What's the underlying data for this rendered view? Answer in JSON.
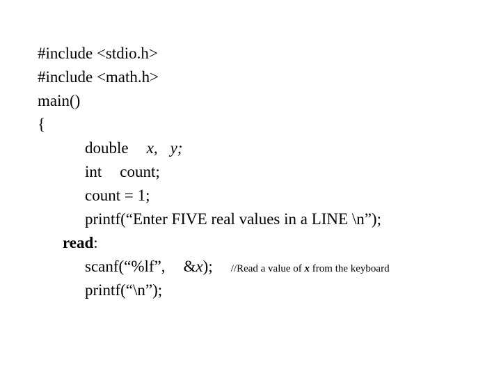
{
  "document": {
    "type": "c-source-code-listing",
    "background_color": "#ffffff",
    "text_color": "#000000",
    "lines": [
      {
        "id": "include-stdio",
        "indent": "top",
        "text": "#include <stdio.h>"
      },
      {
        "id": "include-math",
        "indent": "top",
        "text": "#include <math.h>"
      },
      {
        "id": "main-declaration",
        "indent": "top",
        "text": "main()"
      },
      {
        "id": "open-brace",
        "indent": "top",
        "text": "{"
      },
      {
        "id": "declare-doubles",
        "indent": "body",
        "keyword": "double",
        "var_x": "x,",
        "var_y": "y;"
      },
      {
        "id": "declare-int-count",
        "indent": "body",
        "keyword": "int",
        "identifier": "count;"
      },
      {
        "id": "assign-count",
        "indent": "body",
        "text": "count = 1;"
      },
      {
        "id": "printf-prompt",
        "indent": "body",
        "text": "printf(“Enter FIVE real values in a LINE \\n”);"
      },
      {
        "id": "read-label",
        "indent": "label",
        "label": "read",
        "punctuation": ":"
      },
      {
        "id": "scanf-value",
        "indent": "body",
        "code_before_var": "scanf(“%lf”,",
        "address_operator": "&",
        "var": "x",
        "code_after_var": ");",
        "comment_prefix": "//Read a value of",
        "comment_var": "x",
        "comment_suffix": "from the keyboard"
      },
      {
        "id": "printf-newline",
        "indent": "body",
        "text": "printf(“\\n”);"
      }
    ]
  }
}
